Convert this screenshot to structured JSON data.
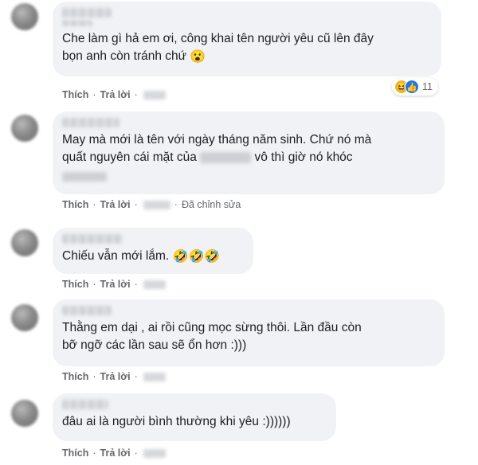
{
  "comments": [
    {
      "text_lines": [
        "Che làm gì hả em ơi, công khai tên người yêu cũ lên đây",
        "bọn anh còn tránh chứ"
      ],
      "emoji": "😮",
      "like_label": "Thích",
      "reply_label": "Trả lời",
      "reactions": {
        "icons": [
          "haha-icon",
          "like-icon"
        ],
        "count": "11"
      }
    },
    {
      "text_lines": [
        "May mà mới là tên với ngày tháng năm sinh. Chứ nó mà",
        "quất nguyên cái mặt của",
        "vô thì giờ nó khóc"
      ],
      "like_label": "Thích",
      "reply_label": "Trả lời",
      "edited_label": "Đã chỉnh sửa"
    },
    {
      "text_lines": [
        "Chiếu vẫn mới lắm."
      ],
      "emoji": "🤣🤣🤣",
      "like_label": "Thích",
      "reply_label": "Trả lời"
    },
    {
      "text_lines": [
        "Thằng em dại , ai rồi cũng mọc sừng thôi. Lần đầu còn",
        "bỡ ngỡ các lần sau sẽ ổn hơn :)))"
      ],
      "like_label": "Thích",
      "reply_label": "Trả lời"
    },
    {
      "text_lines": [
        "đâu ai là người bình thường khi yêu :))))))"
      ],
      "like_label": "Thích",
      "reply_label": "Trả lời"
    }
  ],
  "separator": "·"
}
